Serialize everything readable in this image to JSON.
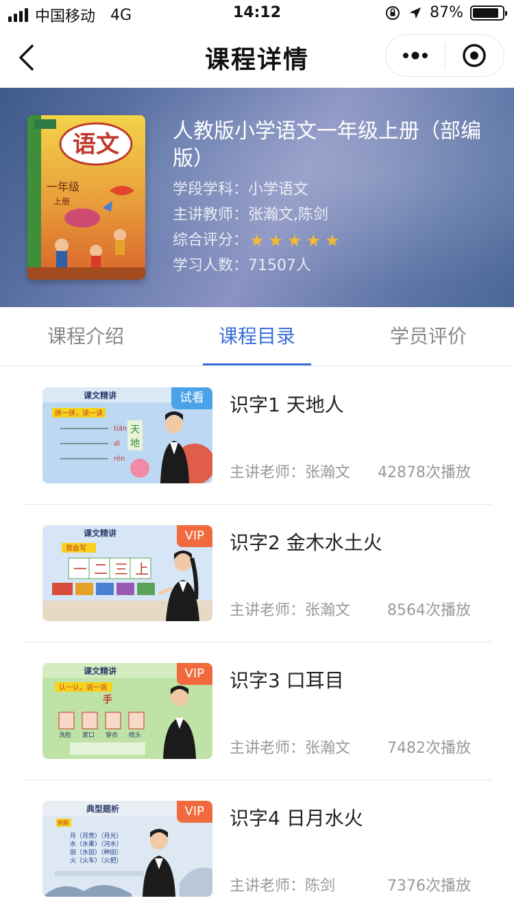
{
  "status_bar": {
    "carrier": "中国移动",
    "network": "4G",
    "time": "14:12",
    "battery_percent": "87%",
    "battery_level": 0.87,
    "icons": [
      "signal-bars-icon",
      "orientation-lock-icon",
      "location-arrow-icon",
      "battery-icon"
    ]
  },
  "nav": {
    "title": "课程详情",
    "icons": [
      "chevron-left-icon",
      "more-dots-icon",
      "target-close-icon"
    ]
  },
  "course": {
    "title": "人教版小学语文一年级上册（部编版）",
    "subject_label": "学段学科：",
    "subject": "小学语文",
    "teacher_label": "主讲教师：",
    "teachers": "张瀚文,陈剑",
    "rating_label": "综合评分：",
    "rating": 5,
    "learners_label": "学习人数：",
    "learners": "71507人",
    "cover": {
      "title": "语文",
      "grade": "一年级",
      "volume": "上册"
    }
  },
  "tabs": [
    {
      "label": "课程介绍",
      "active": false
    },
    {
      "label": "课程目录",
      "active": true
    },
    {
      "label": "学员评价",
      "active": false
    }
  ],
  "lessons": [
    {
      "title": "识字1 天地人",
      "badge": "试看",
      "badge_type": "trial",
      "teacher": "主讲老师：张瀚文",
      "plays": "42878次播放",
      "thumb_header": "课文精讲",
      "thumb_sub": "拼一拼，读一读",
      "thumb_pinyin": [
        "tiān",
        "dì",
        "rén"
      ],
      "thumb_chars": [
        "天",
        "地"
      ]
    },
    {
      "title": "识字2 金木水土火",
      "badge": "VIP",
      "badge_type": "vip",
      "teacher": "主讲老师：张瀚文",
      "plays": "8564次播放",
      "thumb_header": "课文精讲",
      "thumb_sub": "我会写",
      "thumb_chars": [
        "一",
        "二",
        "三",
        "上"
      ]
    },
    {
      "title": "识字3 口耳目",
      "badge": "VIP",
      "badge_type": "vip",
      "teacher": "主讲老师：张瀚文",
      "plays": "7482次播放",
      "thumb_header": "课文精讲",
      "thumb_sub": "认一认，说一说",
      "thumb_char": "手",
      "thumb_words": [
        "洗脸",
        "漱口",
        "穿衣",
        "梳头"
      ]
    },
    {
      "title": "识字4 日月水火",
      "badge": "VIP",
      "badge_type": "vip",
      "teacher": "主讲老师：陈剑",
      "plays": "7376次播放",
      "thumb_header": "典型题析",
      "thumb_sub": "例题",
      "thumb_lines": [
        "月（月亮）（月光）",
        "水（水果）（河水）",
        "田（水田）（种田）",
        "火（火车）（火把）"
      ]
    }
  ]
}
